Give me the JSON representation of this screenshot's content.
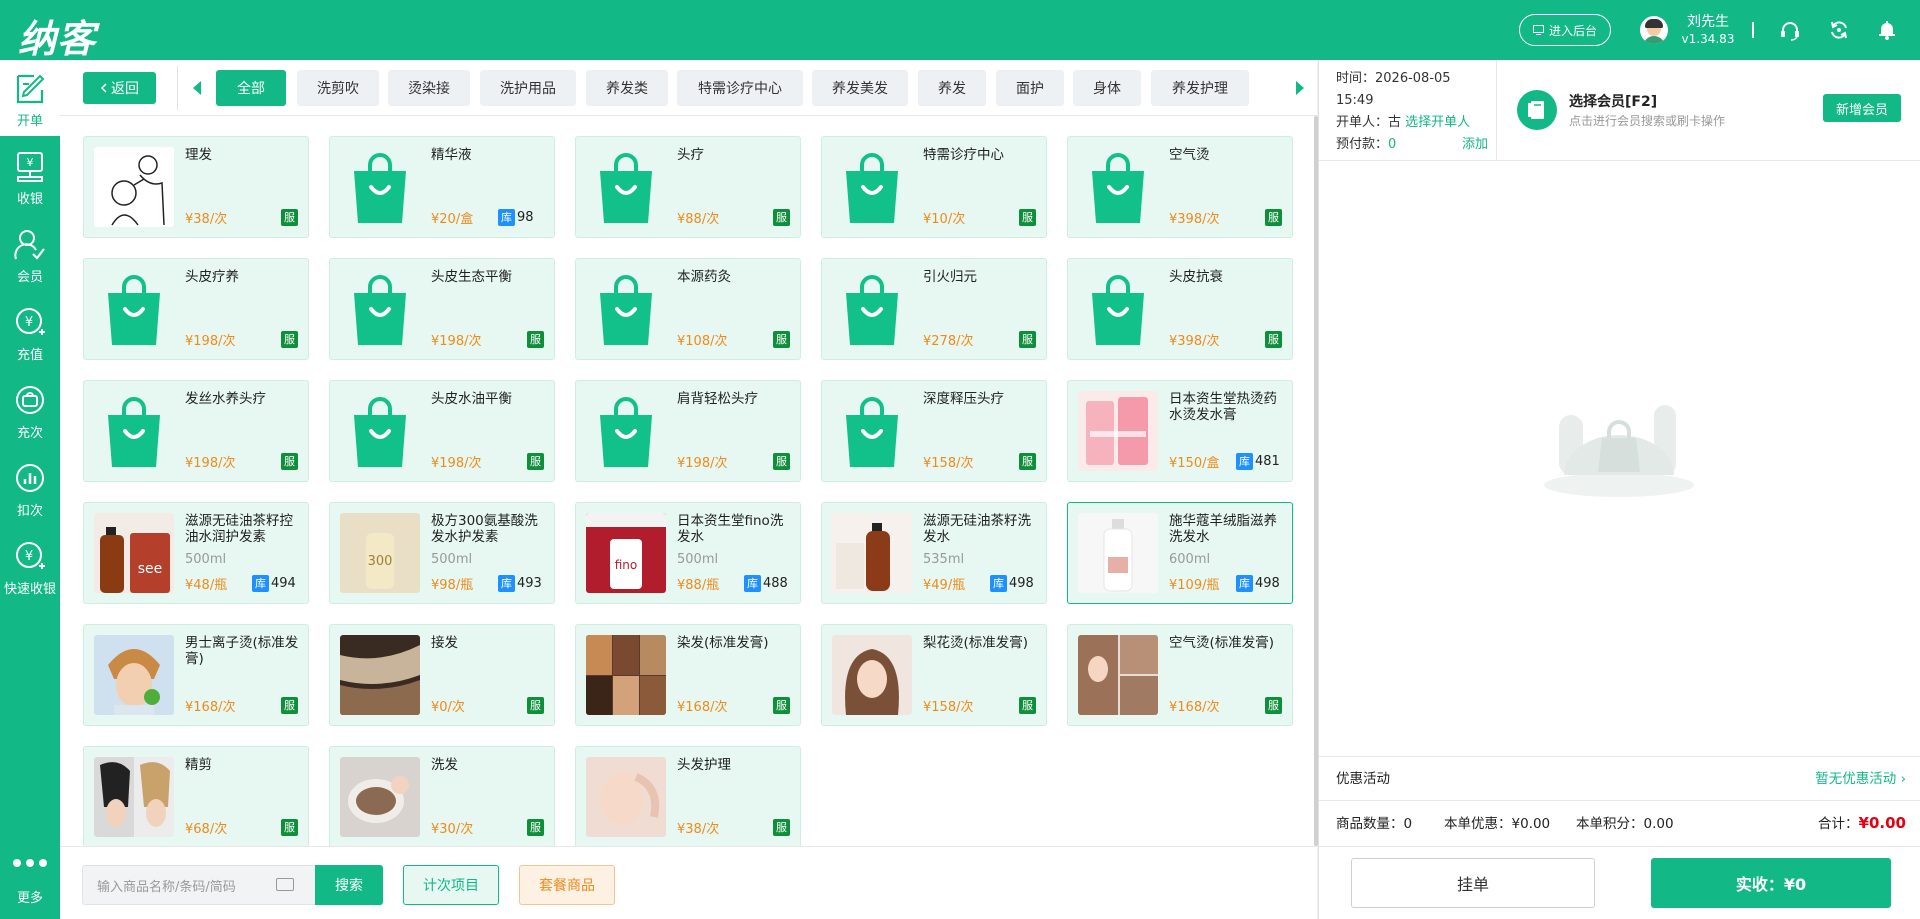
{
  "app": {
    "logo": "纳客"
  },
  "header": {
    "admin_button": "进入后台",
    "user_name": "刘先生",
    "version": "v1.34.83",
    "icons": [
      "headset-icon",
      "refresh-icon",
      "bell-icon"
    ]
  },
  "sidebar": {
    "items": [
      {
        "label": "开单",
        "icon": "edit-order-icon",
        "active": true
      },
      {
        "label": "收银",
        "icon": "cash-register-icon"
      },
      {
        "label": "会员",
        "icon": "member-icon"
      },
      {
        "label": "充值",
        "icon": "recharge-icon"
      },
      {
        "label": "充次",
        "icon": "recharge-times-icon"
      },
      {
        "label": "扣次",
        "icon": "deduct-times-icon"
      },
      {
        "label": "快速收银",
        "icon": "quick-cashier-icon"
      }
    ],
    "more": "更多"
  },
  "categories": {
    "back": "返回",
    "items": [
      "全部",
      "洗剪吹",
      "烫染接",
      "洗护用品",
      "养发类",
      "特需诊疗中心",
      "养发美发",
      "养发",
      "面护",
      "身体",
      "养发护理"
    ],
    "active_index": 0
  },
  "products": [
    {
      "name": "理发",
      "price": "¥38/次",
      "tag": "服",
      "img": "barber"
    },
    {
      "name": "精华液",
      "price": "¥20/盒",
      "stock_tag": "库",
      "stock": "98",
      "img": "bag"
    },
    {
      "name": "头疗",
      "price": "¥88/次",
      "tag": "服",
      "img": "bag"
    },
    {
      "name": "特需诊疗中心",
      "price": "¥10/次",
      "tag": "服",
      "img": "bag"
    },
    {
      "name": "空气烫",
      "price": "¥398/次",
      "tag": "服",
      "img": "bag"
    },
    {
      "name": "头皮疗养",
      "price": "¥198/次",
      "tag": "服",
      "img": "bag"
    },
    {
      "name": "头皮生态平衡",
      "price": "¥198/次",
      "tag": "服",
      "img": "bag"
    },
    {
      "name": "本源药灸",
      "price": "¥108/次",
      "tag": "服",
      "img": "bag"
    },
    {
      "name": "引火归元",
      "price": "¥278/次",
      "tag": "服",
      "img": "bag"
    },
    {
      "name": "头皮抗衰",
      "price": "¥398/次",
      "tag": "服",
      "img": "bag"
    },
    {
      "name": "发丝水养头疗",
      "price": "¥198/次",
      "tag": "服",
      "img": "bag"
    },
    {
      "name": "头皮水油平衡",
      "price": "¥198/次",
      "tag": "服",
      "img": "bag"
    },
    {
      "name": "肩背轻松头疗",
      "price": "¥198/次",
      "tag": "服",
      "img": "bag"
    },
    {
      "name": "深度释压头疗",
      "price": "¥158/次",
      "tag": "服",
      "img": "bag"
    },
    {
      "name": "日本资生堂热烫药水烫发水膏",
      "price": "¥150/盒",
      "stock_tag": "库",
      "stock": "481",
      "img": "pink"
    },
    {
      "name": "滋源无硅油茶籽控油水润护发素",
      "price": "¥48/瓶",
      "spec": "500ml",
      "stock_tag": "库",
      "stock": "494",
      "img": "brown"
    },
    {
      "name": "极方300氨基酸洗发水护发素",
      "price": "¥98/瓶",
      "spec": "500ml",
      "stock_tag": "库",
      "stock": "493",
      "img": "gold"
    },
    {
      "name": "日本资生堂fino洗发水",
      "price": "¥88/瓶",
      "spec": "500ml",
      "stock_tag": "库",
      "stock": "488",
      "img": "red"
    },
    {
      "name": "滋源无硅油茶籽洗发水",
      "price": "¥49/瓶",
      "spec": "535ml",
      "stock_tag": "库",
      "stock": "498",
      "img": "amber"
    },
    {
      "name": "施华蔻羊绒脂滋养洗发水",
      "price": "¥109/瓶",
      "spec": "600ml",
      "stock_tag": "库",
      "stock": "498",
      "img": "whitebottle",
      "selected": true
    },
    {
      "name": "男士离子烫(标准发膏)",
      "price": "¥168/次",
      "tag": "服",
      "img": "man"
    },
    {
      "name": "接发",
      "price": "¥0/次",
      "tag": "服",
      "img": "hairext"
    },
    {
      "name": "染发(标准发膏)",
      "price": "¥168/次",
      "tag": "服",
      "img": "dye"
    },
    {
      "name": "梨花烫(标准发膏)",
      "price": "¥158/次",
      "tag": "服",
      "img": "woman"
    },
    {
      "name": "空气烫(标准发膏)",
      "price": "¥168/次",
      "tag": "服",
      "img": "curls"
    },
    {
      "name": "精剪",
      "price": "¥68/次",
      "tag": "服",
      "img": "cut"
    },
    {
      "name": "洗发",
      "price": "¥30/次",
      "tag": "服",
      "img": "wash"
    },
    {
      "name": "头发护理",
      "price": "¥38/次",
      "tag": "服",
      "img": "face"
    }
  ],
  "bottom": {
    "search_placeholder": "输入商品名称/条码/简码",
    "search_button": "搜索",
    "count_button": "计次项目",
    "package_button": "套餐商品"
  },
  "order": {
    "time_label": "时间：",
    "time_date": "2026-08-05",
    "time_clock": "15:49",
    "creator_label": "开单人：古",
    "creator_link": "选择开单人",
    "prepay_label": "预付款：",
    "prepay_value": "0",
    "prepay_add": "添加"
  },
  "member": {
    "title": "选择会员[F2]",
    "subtitle": "点击进行会员搜索或刷卡操作",
    "new_button": "新增会员"
  },
  "summary": {
    "promo_label": "优惠活动",
    "promo_value": "暂无优惠活动 ›",
    "qty": "商品数量：0",
    "discount": "本单优惠：¥0.00",
    "points": "本单积分：0.00",
    "total_label": "合计：",
    "total_value": "¥0.00",
    "hang_button": "挂单",
    "pay_button": "实收：¥0"
  },
  "colors": {
    "primary": "#12b886",
    "price": "#f08a1c",
    "stock_badge": "#1e90ff",
    "service_badge": "#0e8f3a",
    "total": "#e60012"
  }
}
